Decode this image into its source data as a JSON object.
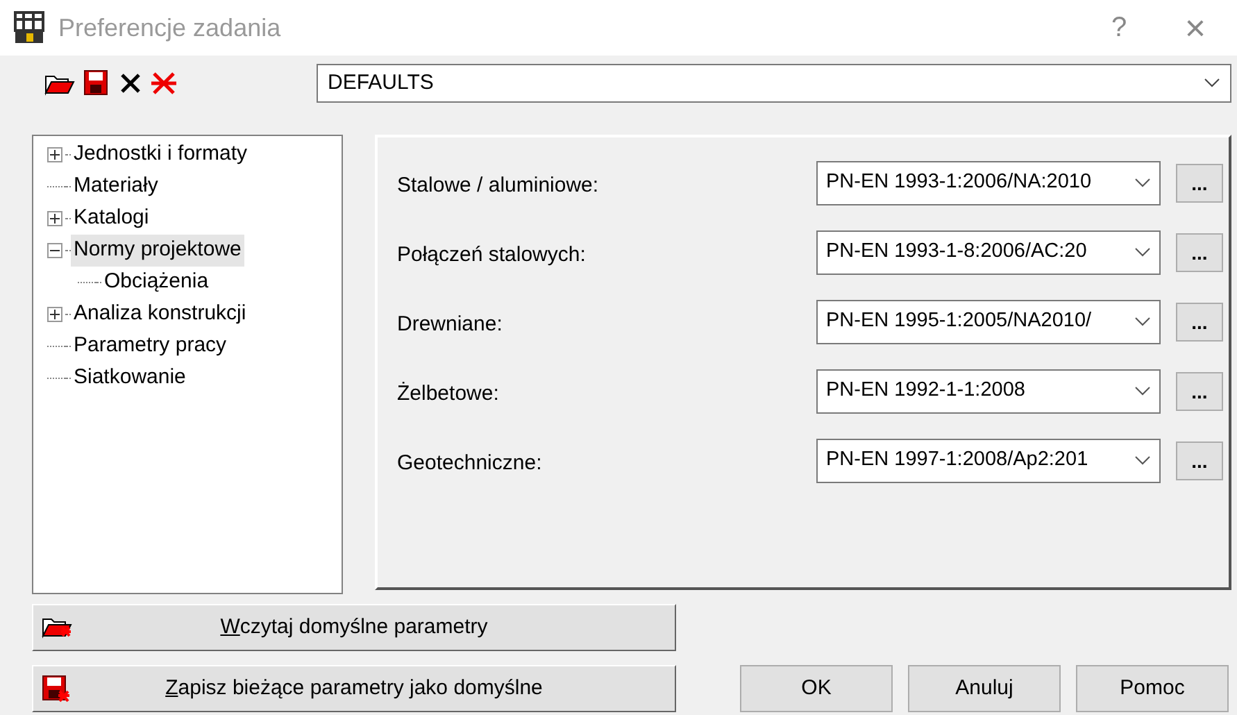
{
  "window": {
    "title": "Preferencje zadania",
    "help": "?",
    "close": "×"
  },
  "toolbar": {
    "preset": "DEFAULTS"
  },
  "tree": [
    {
      "kind": "branch",
      "label": "Jednostki i formaty",
      "expanded": false,
      "selected": false
    },
    {
      "kind": "leaf",
      "label": "Materiały",
      "selected": false
    },
    {
      "kind": "branch",
      "label": "Katalogi",
      "expanded": false,
      "selected": false
    },
    {
      "kind": "branch",
      "label": "Normy projektowe",
      "expanded": true,
      "selected": true,
      "children": [
        {
          "kind": "leaf",
          "label": "Obciążenia",
          "selected": false
        }
      ]
    },
    {
      "kind": "branch",
      "label": "Analiza konstrukcji",
      "expanded": false,
      "selected": false
    },
    {
      "kind": "leaf",
      "label": "Parametry pracy",
      "selected": false
    },
    {
      "kind": "leaf",
      "label": "Siatkowanie",
      "selected": false
    }
  ],
  "norms": [
    {
      "label": "Stalowe / aluminiowe:",
      "value": "PN-EN 1993-1:2006/NA:2010",
      "more": "..."
    },
    {
      "label": "Połączeń stalowych:",
      "value": "PN-EN 1993-1-8:2006/AC:20",
      "more": "..."
    },
    {
      "label": "Drewniane:",
      "value": "PN-EN 1995-1:2005/NA2010/",
      "more": "..."
    },
    {
      "label": "Żelbetowe:",
      "value": "PN-EN 1992-1-1:2008",
      "more": "..."
    },
    {
      "label": "Geotechniczne:",
      "value": "PN-EN 1997-1:2008/Ap2:201",
      "more": "..."
    }
  ],
  "load_defaults": {
    "accel": "W",
    "rest": "czytaj domyślne parametry"
  },
  "save_defaults": {
    "accel": "Z",
    "rest": "apisz bieżące parametry jako domyślne"
  },
  "buttons": [
    "OK",
    "Anuluj",
    "Pomoc"
  ]
}
